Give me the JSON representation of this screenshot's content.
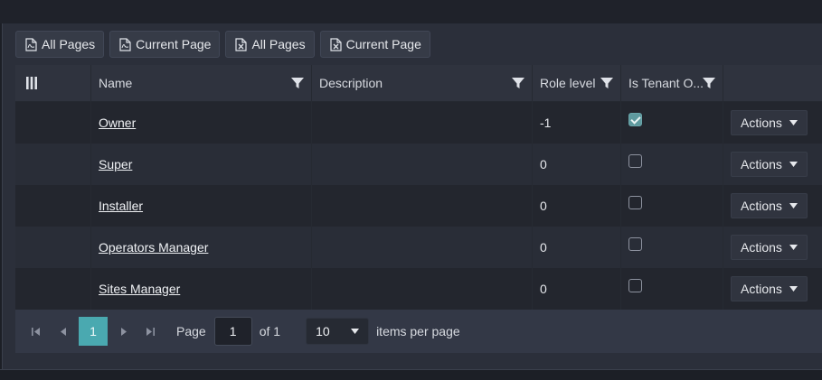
{
  "toolbar": {
    "buttons": [
      {
        "label": "All Pages",
        "icon": "pdf-icon"
      },
      {
        "label": "Current Page",
        "icon": "pdf-icon"
      },
      {
        "label": "All Pages",
        "icon": "excel-icon"
      },
      {
        "label": "Current Page",
        "icon": "excel-icon"
      }
    ]
  },
  "columns": {
    "name": "Name",
    "description": "Description",
    "role_level": "Role level",
    "is_tenant": "Is Tenant O..."
  },
  "rows": [
    {
      "name": "Owner",
      "description": "",
      "role_level": "-1",
      "is_tenant": true,
      "actions": "Actions"
    },
    {
      "name": "Super",
      "description": "",
      "role_level": "0",
      "is_tenant": false,
      "actions": "Actions"
    },
    {
      "name": "Installer",
      "description": "",
      "role_level": "0",
      "is_tenant": false,
      "actions": "Actions"
    },
    {
      "name": "Operators Manager",
      "description": "",
      "role_level": "0",
      "is_tenant": false,
      "actions": "Actions"
    },
    {
      "name": "Sites Manager",
      "description": "",
      "role_level": "0",
      "is_tenant": false,
      "actions": "Actions"
    }
  ],
  "pager": {
    "current_page": "1",
    "page_label": "Page",
    "page_input": "1",
    "of_label": "of 1",
    "page_size": "10",
    "items_label": "items per page"
  },
  "colors": {
    "accent": "#4aa9b0",
    "checked": "#5f9a9f"
  }
}
